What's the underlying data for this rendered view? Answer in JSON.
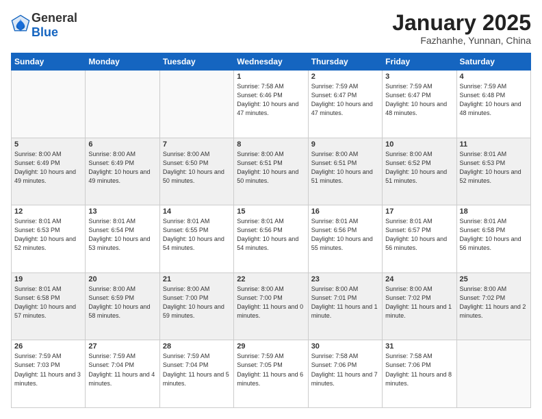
{
  "header": {
    "logo_general": "General",
    "logo_blue": "Blue",
    "title": "January 2025",
    "location": "Fazhanhe, Yunnan, China"
  },
  "days_of_week": [
    "Sunday",
    "Monday",
    "Tuesday",
    "Wednesday",
    "Thursday",
    "Friday",
    "Saturday"
  ],
  "weeks": [
    [
      {
        "num": "",
        "info": ""
      },
      {
        "num": "",
        "info": ""
      },
      {
        "num": "",
        "info": ""
      },
      {
        "num": "1",
        "info": "Sunrise: 7:58 AM\nSunset: 6:46 PM\nDaylight: 10 hours and 47 minutes."
      },
      {
        "num": "2",
        "info": "Sunrise: 7:59 AM\nSunset: 6:47 PM\nDaylight: 10 hours and 47 minutes."
      },
      {
        "num": "3",
        "info": "Sunrise: 7:59 AM\nSunset: 6:47 PM\nDaylight: 10 hours and 48 minutes."
      },
      {
        "num": "4",
        "info": "Sunrise: 7:59 AM\nSunset: 6:48 PM\nDaylight: 10 hours and 48 minutes."
      }
    ],
    [
      {
        "num": "5",
        "info": "Sunrise: 8:00 AM\nSunset: 6:49 PM\nDaylight: 10 hours and 49 minutes."
      },
      {
        "num": "6",
        "info": "Sunrise: 8:00 AM\nSunset: 6:49 PM\nDaylight: 10 hours and 49 minutes."
      },
      {
        "num": "7",
        "info": "Sunrise: 8:00 AM\nSunset: 6:50 PM\nDaylight: 10 hours and 50 minutes."
      },
      {
        "num": "8",
        "info": "Sunrise: 8:00 AM\nSunset: 6:51 PM\nDaylight: 10 hours and 50 minutes."
      },
      {
        "num": "9",
        "info": "Sunrise: 8:00 AM\nSunset: 6:51 PM\nDaylight: 10 hours and 51 minutes."
      },
      {
        "num": "10",
        "info": "Sunrise: 8:00 AM\nSunset: 6:52 PM\nDaylight: 10 hours and 51 minutes."
      },
      {
        "num": "11",
        "info": "Sunrise: 8:01 AM\nSunset: 6:53 PM\nDaylight: 10 hours and 52 minutes."
      }
    ],
    [
      {
        "num": "12",
        "info": "Sunrise: 8:01 AM\nSunset: 6:53 PM\nDaylight: 10 hours and 52 minutes."
      },
      {
        "num": "13",
        "info": "Sunrise: 8:01 AM\nSunset: 6:54 PM\nDaylight: 10 hours and 53 minutes."
      },
      {
        "num": "14",
        "info": "Sunrise: 8:01 AM\nSunset: 6:55 PM\nDaylight: 10 hours and 54 minutes."
      },
      {
        "num": "15",
        "info": "Sunrise: 8:01 AM\nSunset: 6:56 PM\nDaylight: 10 hours and 54 minutes."
      },
      {
        "num": "16",
        "info": "Sunrise: 8:01 AM\nSunset: 6:56 PM\nDaylight: 10 hours and 55 minutes."
      },
      {
        "num": "17",
        "info": "Sunrise: 8:01 AM\nSunset: 6:57 PM\nDaylight: 10 hours and 56 minutes."
      },
      {
        "num": "18",
        "info": "Sunrise: 8:01 AM\nSunset: 6:58 PM\nDaylight: 10 hours and 56 minutes."
      }
    ],
    [
      {
        "num": "19",
        "info": "Sunrise: 8:01 AM\nSunset: 6:58 PM\nDaylight: 10 hours and 57 minutes."
      },
      {
        "num": "20",
        "info": "Sunrise: 8:00 AM\nSunset: 6:59 PM\nDaylight: 10 hours and 58 minutes."
      },
      {
        "num": "21",
        "info": "Sunrise: 8:00 AM\nSunset: 7:00 PM\nDaylight: 10 hours and 59 minutes."
      },
      {
        "num": "22",
        "info": "Sunrise: 8:00 AM\nSunset: 7:00 PM\nDaylight: 11 hours and 0 minutes."
      },
      {
        "num": "23",
        "info": "Sunrise: 8:00 AM\nSunset: 7:01 PM\nDaylight: 11 hours and 1 minute."
      },
      {
        "num": "24",
        "info": "Sunrise: 8:00 AM\nSunset: 7:02 PM\nDaylight: 11 hours and 1 minute."
      },
      {
        "num": "25",
        "info": "Sunrise: 8:00 AM\nSunset: 7:02 PM\nDaylight: 11 hours and 2 minutes."
      }
    ],
    [
      {
        "num": "26",
        "info": "Sunrise: 7:59 AM\nSunset: 7:03 PM\nDaylight: 11 hours and 3 minutes."
      },
      {
        "num": "27",
        "info": "Sunrise: 7:59 AM\nSunset: 7:04 PM\nDaylight: 11 hours and 4 minutes."
      },
      {
        "num": "28",
        "info": "Sunrise: 7:59 AM\nSunset: 7:04 PM\nDaylight: 11 hours and 5 minutes."
      },
      {
        "num": "29",
        "info": "Sunrise: 7:59 AM\nSunset: 7:05 PM\nDaylight: 11 hours and 6 minutes."
      },
      {
        "num": "30",
        "info": "Sunrise: 7:58 AM\nSunset: 7:06 PM\nDaylight: 11 hours and 7 minutes."
      },
      {
        "num": "31",
        "info": "Sunrise: 7:58 AM\nSunset: 7:06 PM\nDaylight: 11 hours and 8 minutes."
      },
      {
        "num": "",
        "info": ""
      }
    ]
  ]
}
